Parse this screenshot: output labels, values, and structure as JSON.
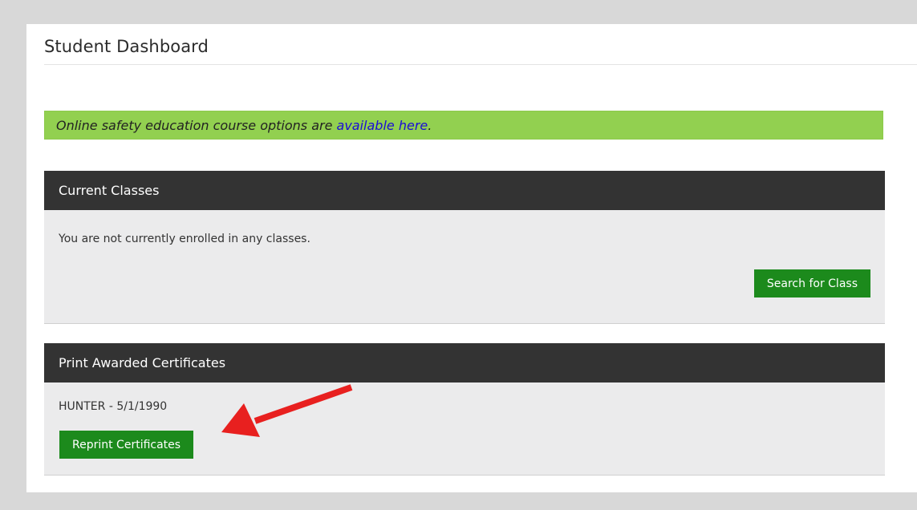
{
  "page_title": "Student Dashboard",
  "banner": {
    "text": "Online safety education course options are ",
    "link_text": "available here",
    "suffix": "."
  },
  "current_classes": {
    "header": "Current Classes",
    "message": "You are not currently enrolled in any classes.",
    "search_button": "Search for Class"
  },
  "certificates": {
    "header": "Print Awarded Certificates",
    "entry": "HUNTER - 5/1/1990",
    "reprint_button": "Reprint Certificates"
  },
  "colors": {
    "banner_bg": "#92d050",
    "panel_header_bg": "#333333",
    "button_green": "#1c8a1c",
    "arrow_red": "#e8201f",
    "link_blue": "#1a0dd6"
  }
}
